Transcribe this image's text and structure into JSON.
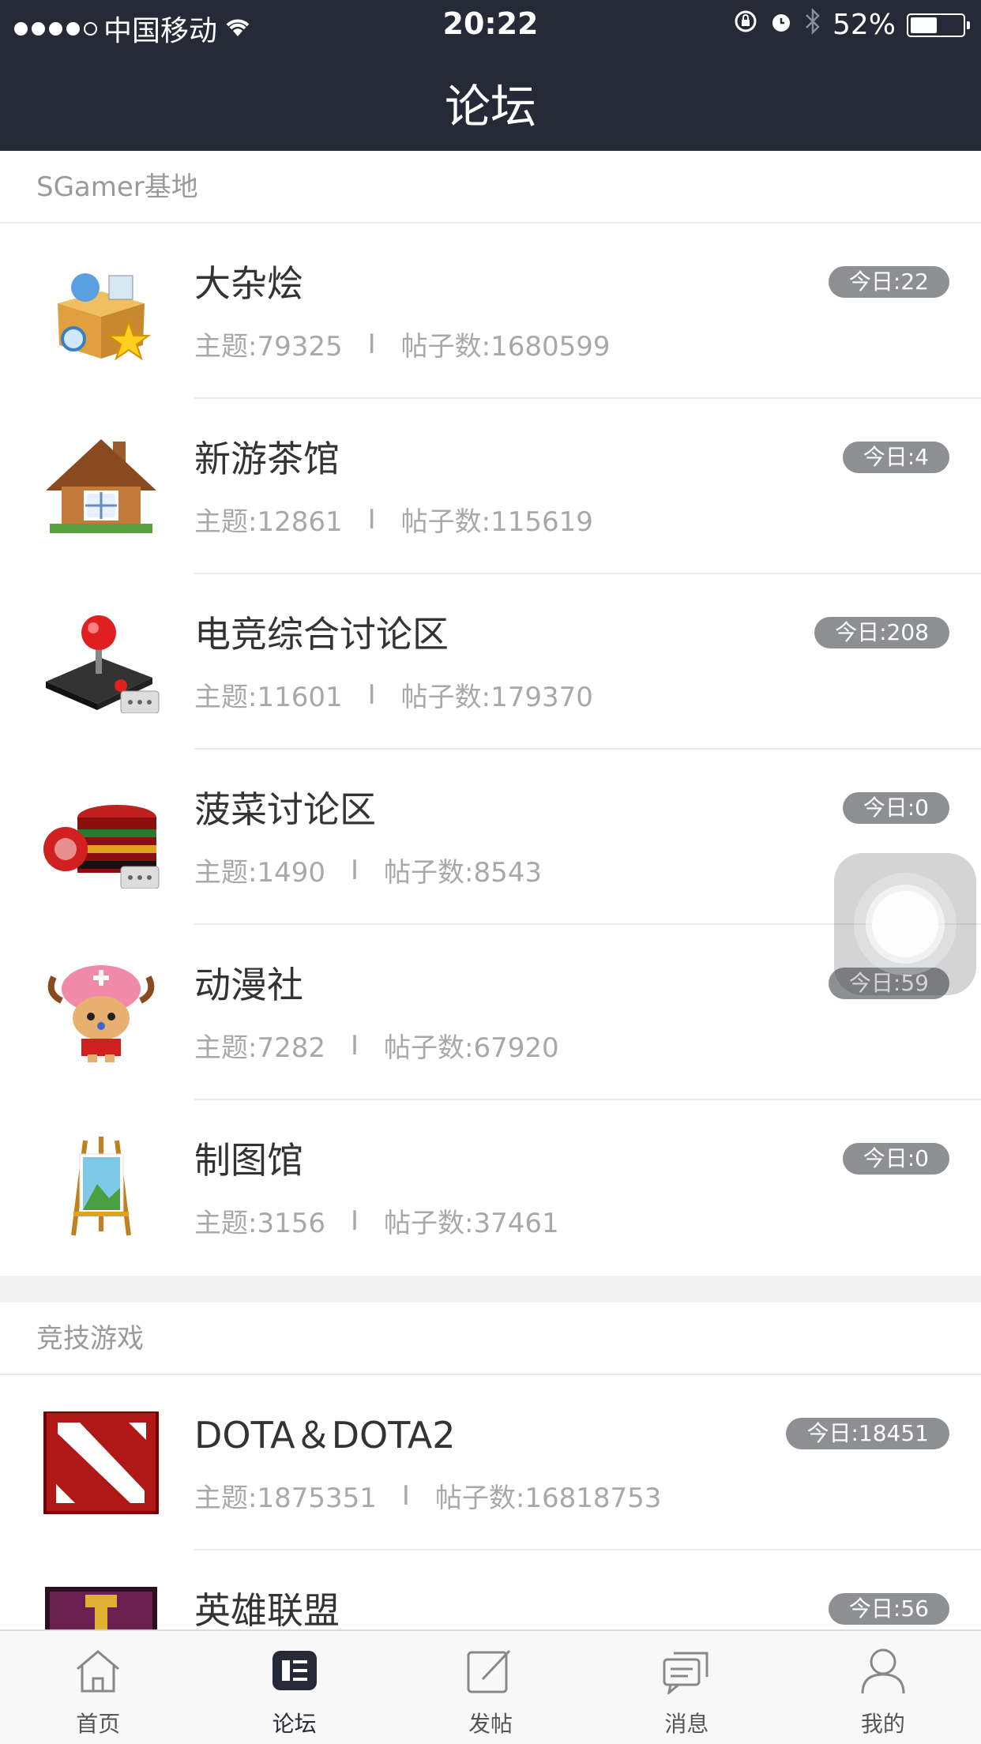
{
  "status_bar": {
    "carrier": "中国移动",
    "time": "20:22",
    "battery": "52%"
  },
  "nav": {
    "title": "论坛"
  },
  "sections": [
    {
      "header": "SGamer基地",
      "forums": [
        {
          "name": "大杂烩",
          "topics_label": "主题:79325",
          "posts_label": "帖子数:1680599",
          "today": "今日:22",
          "icon": "treasure-box-icon"
        },
        {
          "name": "新游茶馆",
          "topics_label": "主题:12861",
          "posts_label": "帖子数:115619",
          "today": "今日:4",
          "icon": "house-icon"
        },
        {
          "name": "电竞综合讨论区",
          "topics_label": "主题:11601",
          "posts_label": "帖子数:179370",
          "today": "今日:208",
          "icon": "joystick-icon"
        },
        {
          "name": "菠菜讨论区",
          "topics_label": "主题:1490",
          "posts_label": "帖子数:8543",
          "today": "今日:0",
          "icon": "poker-chips-icon"
        },
        {
          "name": "动漫社",
          "topics_label": "主题:7282",
          "posts_label": "帖子数:67920",
          "today": "今日:59",
          "icon": "anime-character-icon"
        },
        {
          "name": "制图馆",
          "topics_label": "主题:3156",
          "posts_label": "帖子数:37461",
          "today": "今日:0",
          "icon": "easel-icon"
        }
      ]
    },
    {
      "header": "竞技游戏",
      "forums": [
        {
          "name": "DOTA＆DOTA2",
          "topics_label": "主题:1875351",
          "posts_label": "帖子数:16818753",
          "today": "今日:18451",
          "icon": "dota-logo-icon"
        },
        {
          "name": "英雄联盟",
          "topics_label": "",
          "posts_label": "",
          "today": "今日:56",
          "icon": "lol-logo-icon"
        }
      ]
    }
  ],
  "tabbar": {
    "tabs": [
      {
        "label": "首页",
        "icon": "home-icon",
        "active": false
      },
      {
        "label": "论坛",
        "icon": "forum-icon",
        "active": true
      },
      {
        "label": "发帖",
        "icon": "compose-icon",
        "active": false
      },
      {
        "label": "消息",
        "icon": "message-icon",
        "active": false
      },
      {
        "label": "我的",
        "icon": "profile-icon",
        "active": false
      }
    ]
  },
  "colors": {
    "nav_bg": "#262a36",
    "badge_bg": "#8e8f93",
    "divider": "#ececec",
    "section_gap": "#f2f2f2"
  }
}
